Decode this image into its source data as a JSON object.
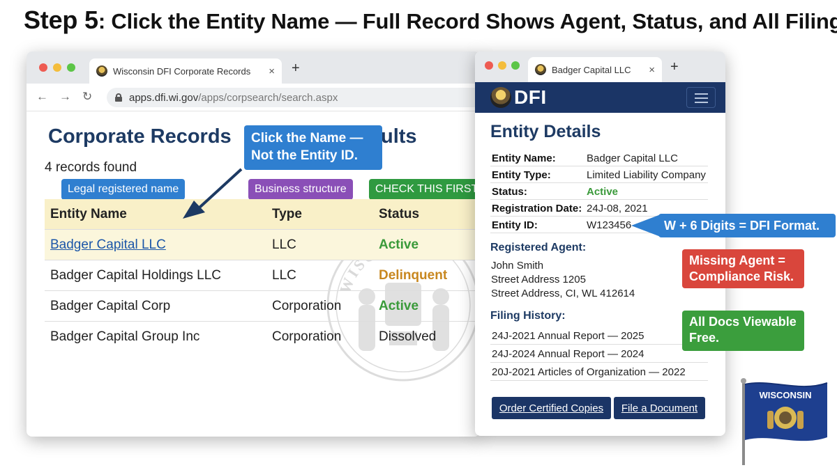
{
  "step_title": {
    "lead": "Step 5",
    "rest": ": Click the Entity Name — Full Record Shows Agent, Status, and All Filings"
  },
  "main_window": {
    "tab_title": "Wisconsin DFI Corporate Records",
    "tab_close": "×",
    "new_tab": "+",
    "url_domain": "apps.dfi.wi.gov",
    "url_path": "/apps/corpsearch/search.aspx",
    "heading": "Corporate Records",
    "heading_tail": "ults",
    "record_count": "4 records found",
    "callout": "Click the Name — Not the Entity ID.",
    "labels": {
      "legal_name": "Legal registered name",
      "business_structure": "Business structure",
      "check_first": "CHECK THIS FIRST"
    },
    "table": {
      "headers": [
        "Entity Name",
        "Type",
        "Status"
      ],
      "rows": [
        {
          "name": "Badger Capital LLC",
          "type": "LLC",
          "status": "Active"
        },
        {
          "name": "Badger Capital Holdings LLC",
          "type": "LLC",
          "status": "Delinquent"
        },
        {
          "name": "Badger Capital Corp",
          "type": "Corporation",
          "status": "Active"
        },
        {
          "name": "Badger Capital Group Inc",
          "type": "Corporation",
          "status": "Dissolved"
        }
      ]
    },
    "watermark_text": "WISCONSIN"
  },
  "detail_window": {
    "tab_title": "Badger Capital LLC",
    "tab_close": "×",
    "new_tab": "+",
    "brand": "DFI",
    "heading": "Entity Details",
    "fields": [
      {
        "key": "Entity Name:",
        "value": "Badger Capital LLC"
      },
      {
        "key": "Entity Type:",
        "value": "Limited Liability Company"
      },
      {
        "key": "Status:",
        "value": "Active"
      },
      {
        "key": "Registration Date:",
        "value": "24J-08, 2021"
      },
      {
        "key": "Entity ID:",
        "value": "W123456"
      }
    ],
    "agent_heading": "Registered Agent:",
    "agent_lines": [
      "John Smith",
      "Street Address 1205",
      "Street Address, CI, WL 412614"
    ],
    "filing_heading": "Filing History:",
    "filings": [
      "24J-2021  Annual Report — 2025",
      "24J-2024  Annual Report — 2024",
      "20J-2021  Articles of Organization — 2022"
    ],
    "buttons": {
      "order": "Order Certified Copies",
      "file": "File a Document"
    }
  },
  "callouts": {
    "id_format": "W + 6 Digits = DFI Format.",
    "missing_agent": "Missing Agent = Compliance Risk.",
    "docs_free": "All Docs Viewable Free."
  },
  "flag_text": "WISCONSIN",
  "colors": {
    "navy": "#1b3566",
    "heading_blue": "#1d3a63",
    "callout_blue": "#2f7fd0",
    "callout_red": "#d9463c",
    "callout_green": "#3b9e3d",
    "badge_purple": "#8a4fb7",
    "status_active": "#3a9a3a",
    "status_delinquent": "#c8871f"
  }
}
